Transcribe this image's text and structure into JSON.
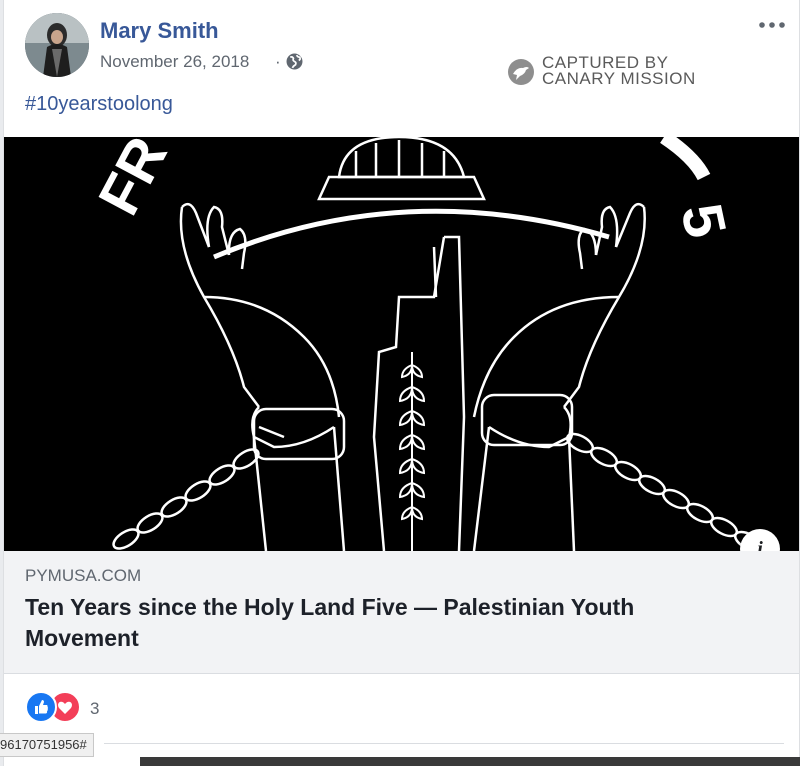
{
  "post": {
    "author": "Mary Smith",
    "date": "November 26, 2018",
    "separator": "·",
    "privacy_icon": "globe-icon",
    "more_icon": "more-options-icon",
    "hashtag": "#10yearstoolong"
  },
  "watermark": {
    "line1": "CAPTURED BY",
    "line2": "CANARY MISSION"
  },
  "link_preview": {
    "image_text_left": "FR",
    "image_text_right": "5",
    "domain": "PYMUSA.COM",
    "title": "Ten Years since the Holy Land Five — Palestinian Youth Movement",
    "info_label": "i"
  },
  "reactions": {
    "types": [
      "like",
      "love"
    ],
    "count": "3"
  },
  "status_bar": {
    "url_fragment": "96170751956#"
  },
  "colors": {
    "link_blue": "#385898",
    "like_blue": "#1877f2",
    "love_red": "#f33e58",
    "meta_bg": "#f2f3f5"
  }
}
